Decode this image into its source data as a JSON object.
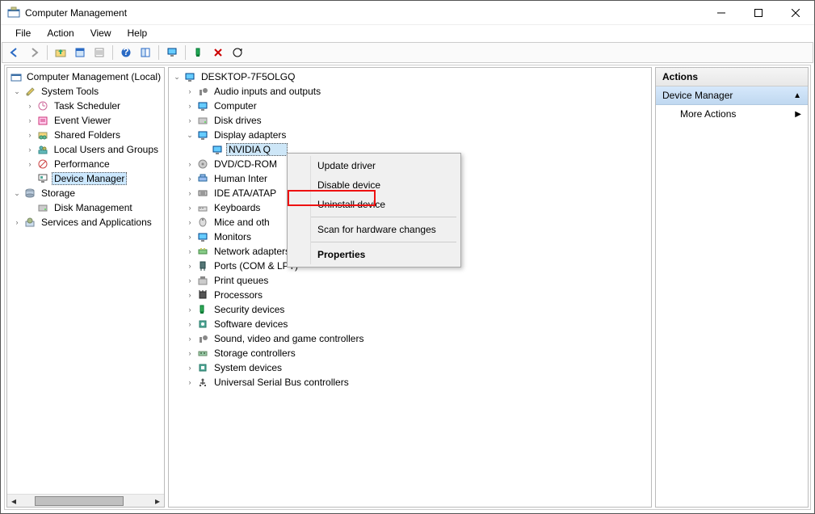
{
  "window": {
    "title": "Computer Management"
  },
  "menubar": {
    "items": [
      "File",
      "Action",
      "View",
      "Help"
    ]
  },
  "toolbar_icons": [
    "nav-back-icon",
    "nav-forward-icon",
    "|",
    "folder-up-icon",
    "properties-icon",
    "list-icon",
    "|",
    "help-icon",
    "show-hide-icon",
    "|",
    "monitor-icon",
    "|",
    "plug-play-icon",
    "remove-icon",
    "refresh-circle-icon"
  ],
  "left_tree": {
    "root": {
      "label": "Computer Management (Local)"
    },
    "system_tools": {
      "label": "System Tools",
      "children": {
        "task_scheduler": "Task Scheduler",
        "event_viewer": "Event Viewer",
        "shared_folders": "Shared Folders",
        "local_users": "Local Users and Groups",
        "performance": "Performance",
        "device_manager": "Device Manager"
      }
    },
    "storage": {
      "label": "Storage",
      "children": {
        "disk_management": "Disk Management"
      }
    },
    "services": {
      "label": "Services and Applications"
    }
  },
  "middle_tree": {
    "root": "DESKTOP-7F5OLGQ",
    "categories": [
      "Audio inputs and outputs",
      "Computer",
      "Disk drives",
      "Display adapters",
      "DVD/CD-ROM",
      "Human Inter",
      "IDE ATA/ATAP",
      "Keyboards",
      "Mice and oth",
      "Monitors",
      "Network adapters",
      "Ports (COM & LPT)",
      "Print queues",
      "Processors",
      "Security devices",
      "Software devices",
      "Sound, video and game controllers",
      "Storage controllers",
      "System devices",
      "Universal Serial Bus controllers"
    ],
    "display_adapter_child": "NVIDIA Q"
  },
  "context_menu": {
    "items": [
      {
        "label": "Update driver"
      },
      {
        "label": "Disable device"
      },
      {
        "label": "Uninstall device",
        "highlighted": true
      },
      {
        "sep": true
      },
      {
        "label": "Scan for hardware changes"
      },
      {
        "sep": true
      },
      {
        "label": "Properties",
        "bold": true
      }
    ]
  },
  "actions": {
    "header": "Actions",
    "section": "Device Manager",
    "items": [
      "More Actions"
    ]
  }
}
